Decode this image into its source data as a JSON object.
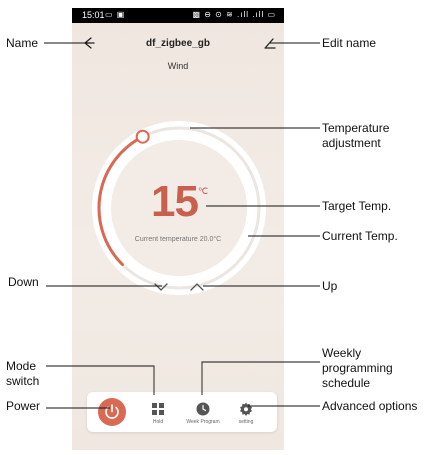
{
  "status_bar": {
    "time": "15:01",
    "left_icons": "▭ ▣",
    "right_icons": "▩ ⊖ ⊙ ≋ .ıll .ıll ▭"
  },
  "header": {
    "device_name": "df_zigbee_gb",
    "mode": "Wind"
  },
  "thermostat": {
    "target_temp": "15",
    "unit": "℃",
    "current_temp_text": "Current temperature 20.0°C",
    "dial_level": 0.4
  },
  "toolbar": {
    "hold_label": "Hold",
    "week_program_label": "Week Program",
    "setting_label": "setting"
  },
  "annotations": {
    "name": "Name",
    "edit_name": "Edit name",
    "temperature_adjustment": [
      "Temperature",
      "adjustment"
    ],
    "target_temp": "Target Temp.",
    "current_temp": "Current Temp.",
    "down": "Down",
    "up": "Up",
    "mode_switch": [
      "Mode",
      "switch"
    ],
    "weekly_schedule": [
      "Weekly",
      "programming",
      "schedule"
    ],
    "power": "Power",
    "advanced_options": "Advanced options"
  },
  "colors": {
    "accent": "#d86a54",
    "dial_track": "#e9e4e0",
    "background": "#f2ebe5"
  }
}
